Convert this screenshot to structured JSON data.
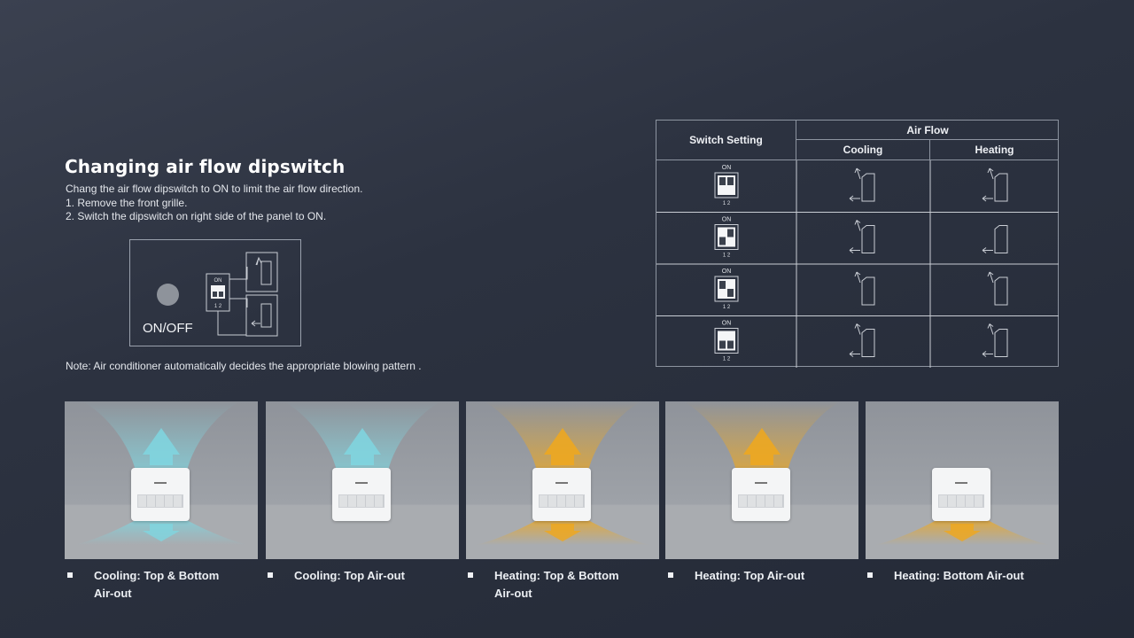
{
  "heading": "Changing air flow dipswitch",
  "description": [
    "Chang the air flow dipswitch to ON to limit the air flow direction.",
    "1. Remove the front grille.",
    "2. Switch the dipswitch on right side of the panel to ON."
  ],
  "panel": {
    "button_label": "ON/OFF",
    "dip_on_label": "ON",
    "dip_num_label": "1  2"
  },
  "note": "Note: Air conditioner automatically decides the appropriate blowing pattern .",
  "table": {
    "col_switch": "Switch  Setting",
    "col_airflow": "Air Flow",
    "col_cooling": "Cooling",
    "col_heating": "Heating",
    "dip_on_label": "ON",
    "dip_num_label": "1  2",
    "rows": [
      {
        "switch1": "off",
        "switch2": "off",
        "cooling": "top-bottom",
        "heating": "top-bottom"
      },
      {
        "switch1": "on",
        "switch2": "off",
        "cooling": "top-bottom",
        "heating": "bottom"
      },
      {
        "switch1": "off",
        "switch2": "on",
        "cooling": "top",
        "heating": "top"
      },
      {
        "switch1": "on",
        "switch2": "on",
        "cooling": "top-bottom",
        "heating": "top-bottom"
      }
    ]
  },
  "cards": [
    {
      "caption": "Cooling: Top & Bottom Air-out",
      "mode": "cooling",
      "top": true,
      "bottom": true
    },
    {
      "caption": "Cooling: Top Air-out",
      "mode": "cooling",
      "top": true,
      "bottom": false
    },
    {
      "caption": "Heating: Top & Bottom Air-out",
      "mode": "heating",
      "top": true,
      "bottom": true
    },
    {
      "caption": "Heating: Top Air-out",
      "mode": "heating",
      "top": true,
      "bottom": false
    },
    {
      "caption": "Heating: Bottom Air-out",
      "mode": "heating",
      "top": false,
      "bottom": true
    }
  ],
  "colors": {
    "cooling": "#7fd6e0",
    "heating": "#f0a81c",
    "line": "#c9cdd4"
  }
}
